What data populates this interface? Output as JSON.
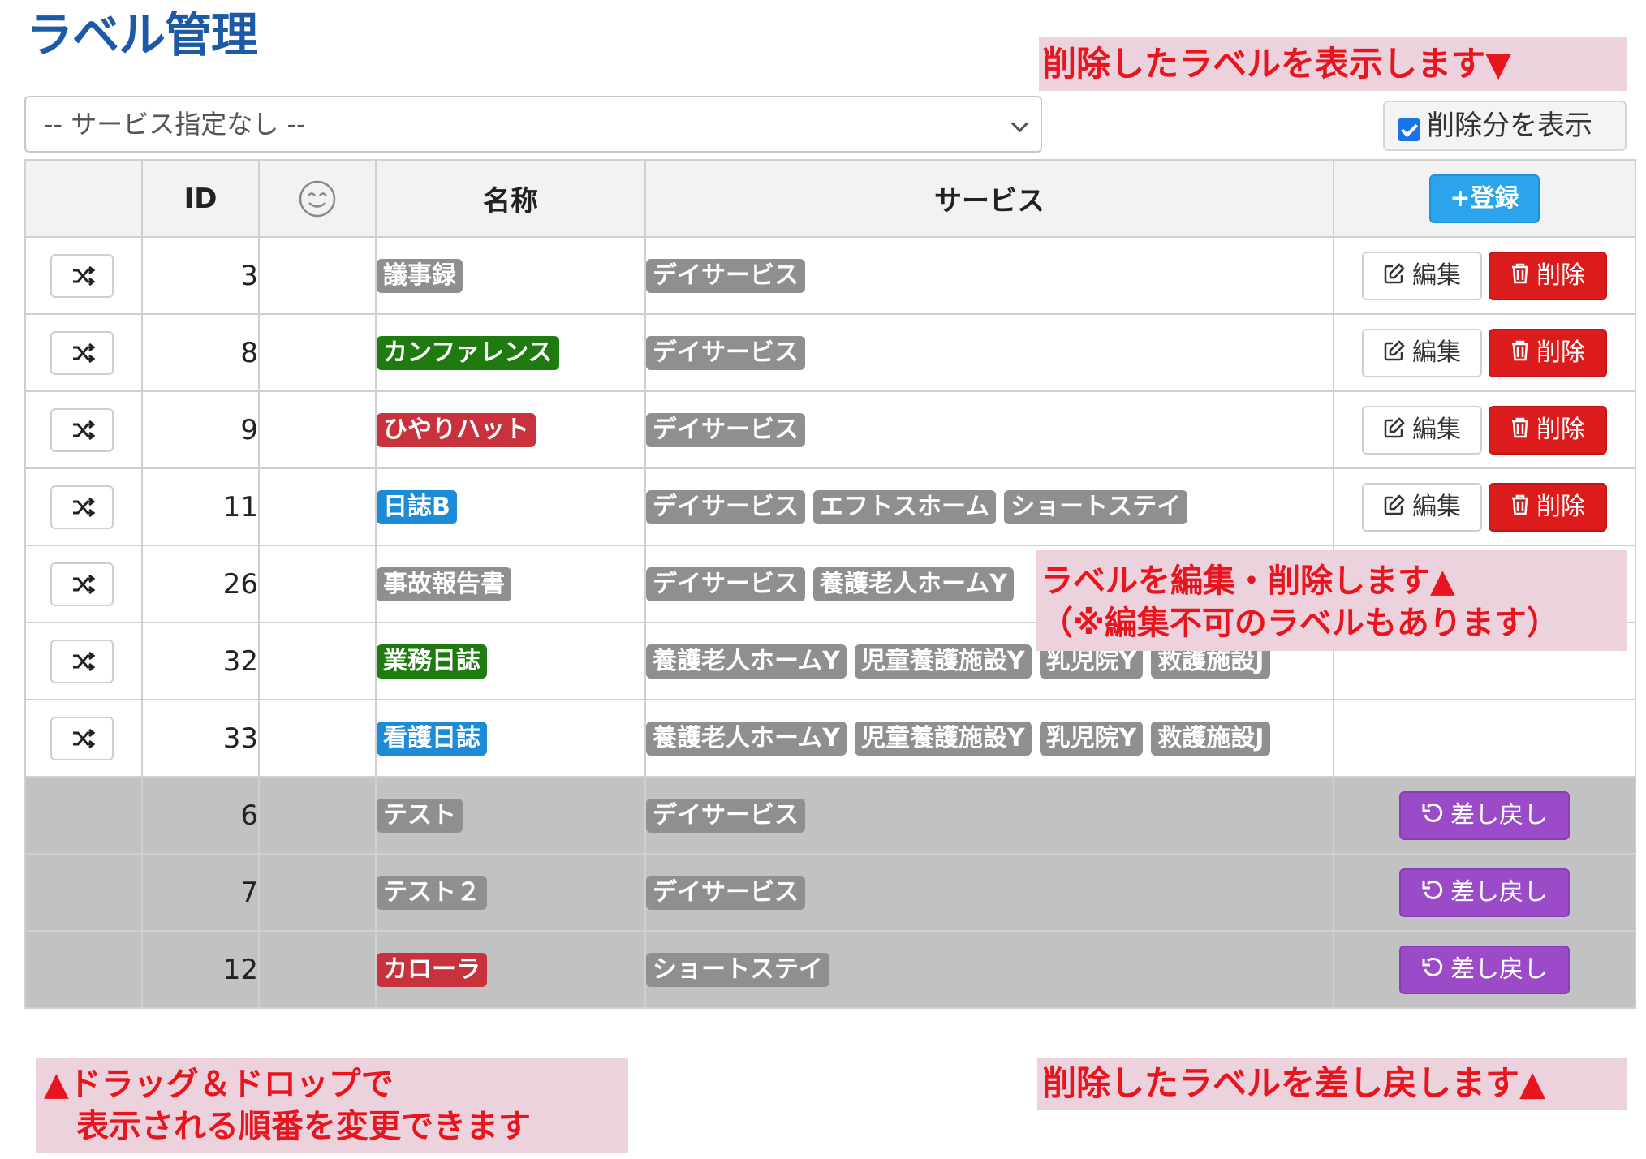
{
  "page": {
    "title": "ラベル管理"
  },
  "callouts": {
    "top": "削除したラベルを表示します▼",
    "mid": "ラベルを編集・削除します▲\n（※編集不可のラベルもあります）",
    "bottom_left": "▲ドラッグ＆ドロップで\n　表示される順番を変更できます",
    "bottom_right": "削除したラベルを差し戻します▲"
  },
  "filter": {
    "service_select_value": "-- サービス指定なし --",
    "show_deleted_label": "削除分を表示",
    "show_deleted_checked": true
  },
  "table": {
    "headers": {
      "drag": "",
      "id": "ID",
      "icon": "smiley-icon",
      "name": "名称",
      "service": "サービス",
      "action": "+登録"
    },
    "buttons": {
      "edit": "編集",
      "delete": "削除",
      "restore": "差し戻し"
    },
    "rows": [
      {
        "id": "3",
        "name": "議事録",
        "name_color": "gray",
        "services": [
          "デイサービス"
        ],
        "state": "active",
        "editable": true
      },
      {
        "id": "8",
        "name": "カンファレンス",
        "name_color": "green",
        "services": [
          "デイサービス"
        ],
        "state": "active",
        "editable": true
      },
      {
        "id": "9",
        "name": "ひやりハット",
        "name_color": "red",
        "services": [
          "デイサービス"
        ],
        "state": "active",
        "editable": true
      },
      {
        "id": "11",
        "name": "日誌B",
        "name_color": "blue",
        "services": [
          "デイサービス",
          "エフトスホーム",
          "ショートステイ"
        ],
        "state": "active",
        "editable": true
      },
      {
        "id": "26",
        "name": "事故報告書",
        "name_color": "gray",
        "services": [
          "デイサービス",
          "養護老人ホームY"
        ],
        "state": "active",
        "editable": false
      },
      {
        "id": "32",
        "name": "業務日誌",
        "name_color": "green",
        "services": [
          "養護老人ホームY",
          "児童養護施設Y",
          "乳児院Y",
          "救護施設J"
        ],
        "state": "active",
        "editable": false
      },
      {
        "id": "33",
        "name": "看護日誌",
        "name_color": "blue",
        "services": [
          "養護老人ホームY",
          "児童養護施設Y",
          "乳児院Y",
          "救護施設J"
        ],
        "state": "active",
        "editable": false
      },
      {
        "id": "6",
        "name": "テスト",
        "name_color": "gray",
        "services": [
          "デイサービス"
        ],
        "state": "deleted"
      },
      {
        "id": "7",
        "name": "テスト２",
        "name_color": "gray",
        "services": [
          "デイサービス"
        ],
        "state": "deleted"
      },
      {
        "id": "12",
        "name": "カローラ",
        "name_color": "red",
        "services": [
          "ショートステイ"
        ],
        "state": "deleted"
      }
    ]
  },
  "colors": {
    "title": "#1c5aa8",
    "callout_bg": "#ecd2dc",
    "callout_text": "#e8141e",
    "add": "#2aa4ea",
    "delete": "#dc1c1c",
    "restore": "#9b4bc8",
    "deleted_row": "#c2c2c2"
  },
  "icons": {
    "drag": "shuffle-icon",
    "edit": "pencil-square-icon",
    "delete": "trash-icon",
    "restore": "undo-icon",
    "header_icon": "smiley-icon"
  }
}
